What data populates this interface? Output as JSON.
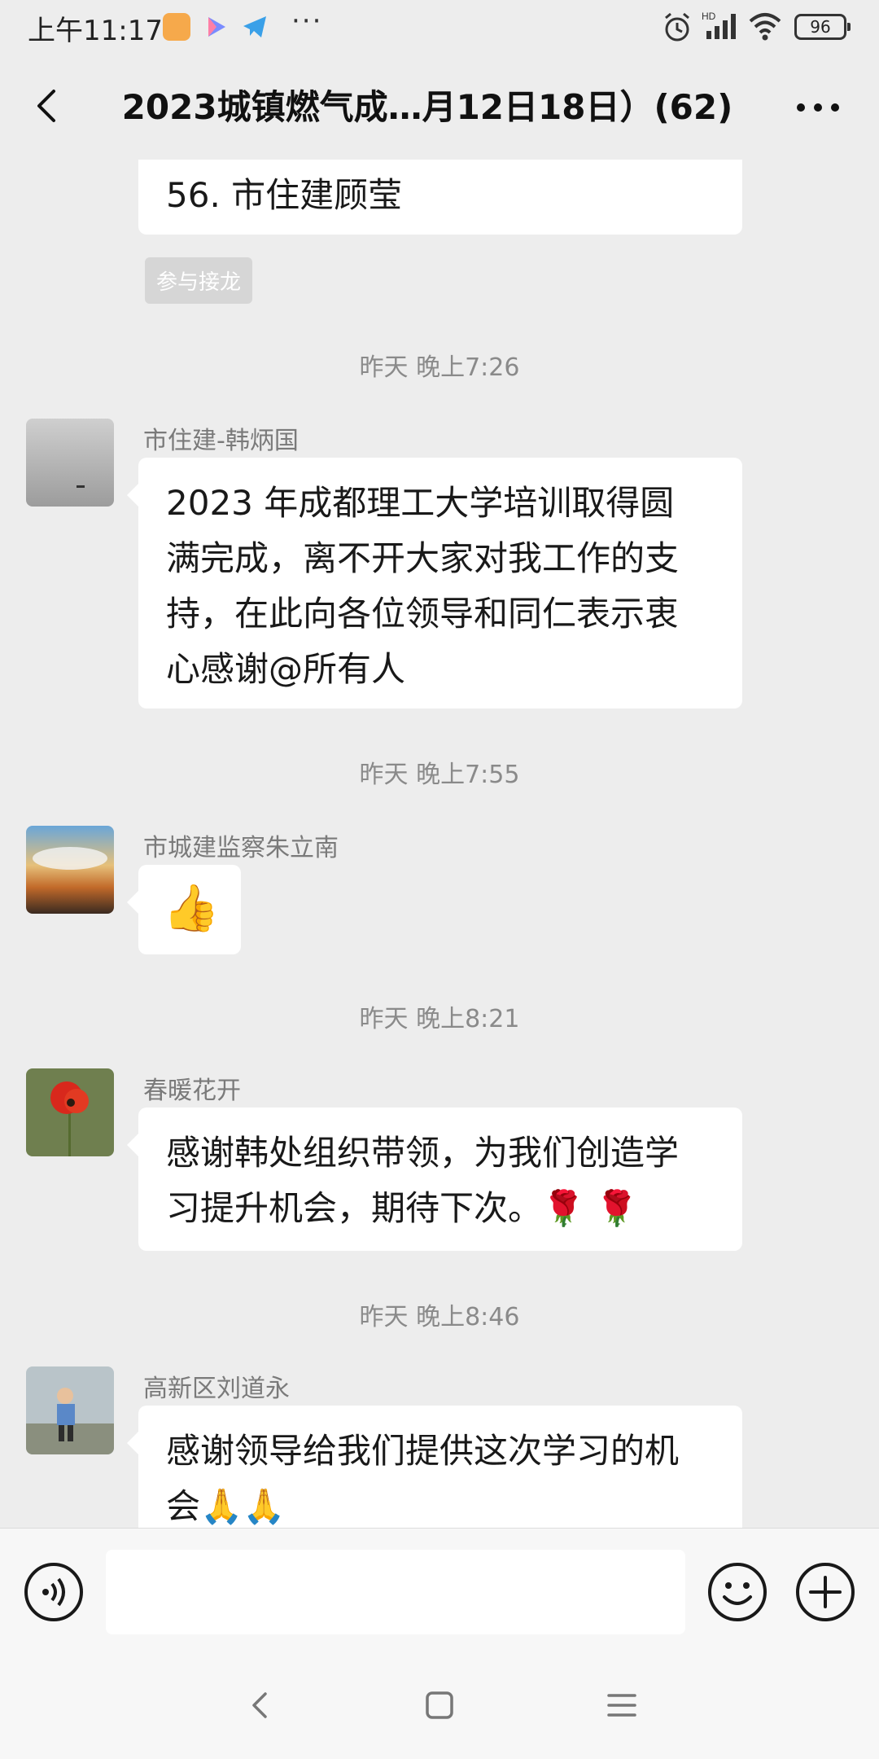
{
  "status_bar": {
    "time": "上午11:17",
    "app_icons": [
      "notes-app-icon",
      "play-app-icon",
      "telegram-app-icon"
    ],
    "more_dots": "···",
    "network": "HD",
    "battery": "96"
  },
  "header": {
    "title": "2023城镇燃气成…月12日18日）(62)",
    "back_icon": "chevron-left-icon",
    "more_icon": "more-dots-icon"
  },
  "messages": [
    {
      "type": "partial_bubble",
      "text": "56. 市住建顾莹",
      "badge": "参与接龙"
    },
    {
      "timestamp": "昨天 晚上7:26",
      "sender": "市住建-韩炳国",
      "text": "2023 年成都理工大学培训取得圆满完成，离不开大家对我工作的支持，在此向各位领导和同仁表示衷心感谢@所有人",
      "lines": [
        "2023 年成都理工大学培训取得圆",
        "满完成，离不开大家对我工作的支",
        "持，在此向各位领导和同仁表示衷",
        "心感谢@所有人"
      ]
    },
    {
      "timestamp": "昨天 晚上7:55",
      "sender": "市城建监察朱立南",
      "text": "👍"
    },
    {
      "timestamp": "昨天 晚上8:21",
      "sender": "春暖花开",
      "lines": [
        "感谢韩处组织带领，为我们创造学",
        "习提升机会，期待下次。🌹 🌹"
      ]
    },
    {
      "timestamp": "昨天 晚上8:46",
      "sender": "高新区刘道永",
      "lines": [
        "感谢领导给我们提供这次学习的机",
        "会🙏🙏"
      ]
    }
  ],
  "input_bar": {
    "placeholder": "",
    "voice_icon": "voice-icon",
    "emoji_icon": "emoji-icon",
    "plus_icon": "plus-icon"
  },
  "nav": {
    "back_icon": "nav-back-icon",
    "home_icon": "nav-home-icon",
    "menu_icon": "nav-menu-icon"
  },
  "colors": {
    "background": "#ededed",
    "bubble": "#ffffff",
    "timestamp_text": "#8a8a8a",
    "badge_bg": "#d6d6d6"
  }
}
